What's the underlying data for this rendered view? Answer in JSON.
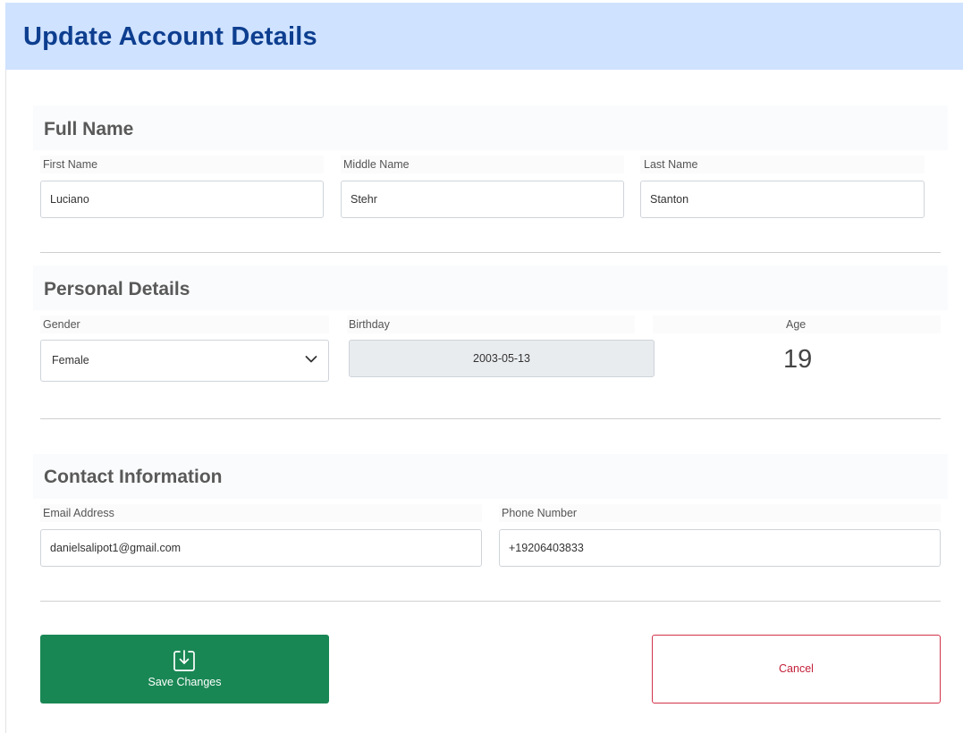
{
  "page": {
    "title": "Update Account Details"
  },
  "full_name": {
    "heading": "Full Name",
    "first_name": {
      "label": "First Name",
      "value": "Luciano"
    },
    "middle_name": {
      "label": "Middle Name",
      "value": "Stehr"
    },
    "last_name": {
      "label": "Last Name",
      "value": "Stanton"
    }
  },
  "personal": {
    "heading": "Personal Details",
    "gender": {
      "label": "Gender",
      "value": "Female",
      "icon": "chevron-down-icon"
    },
    "birthday": {
      "label": "Birthday",
      "value": "2003-05-13"
    },
    "age": {
      "label": "Age",
      "value": "19"
    }
  },
  "contact": {
    "heading": "Contact Information",
    "email": {
      "label": "Email Address",
      "value": "danielsalipot1@gmail.com"
    },
    "phone": {
      "label": "Phone Number",
      "value": "+19206403833"
    }
  },
  "actions": {
    "save_label": "Save Changes",
    "save_icon": "download-box-icon",
    "cancel_label": "Cancel",
    "save_color": "#198754",
    "cancel_color": "#c3203a"
  },
  "colors": {
    "header_bg": "#cfe2ff",
    "title": "#0d3e8f"
  }
}
